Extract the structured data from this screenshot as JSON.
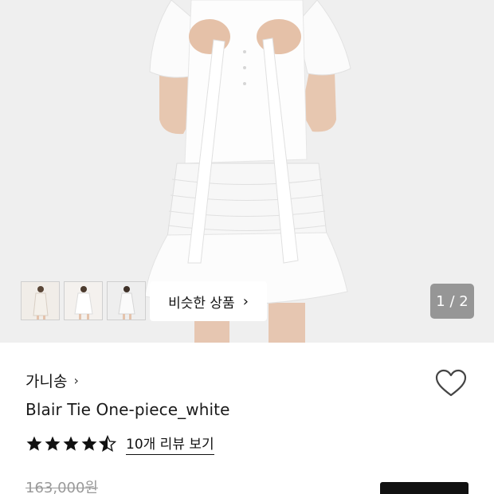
{
  "gallery": {
    "similar_button_label": "비슷한 상품",
    "similar_button_chevron": "›",
    "pager_text": "1 / 2",
    "thumbnails": [
      "thumb-1",
      "thumb-2",
      "thumb-3"
    ]
  },
  "product": {
    "brand_name": "가니송",
    "brand_chevron": "›",
    "title": "Blair Tie One-piece_white",
    "rating_stars": 4.5,
    "reviews_link": "10개 리뷰 보기",
    "original_price": "163,000원"
  },
  "icons": {
    "heart": "heart-outline-icon",
    "star": "star-icon",
    "chevron": "chevron-right-icon"
  },
  "colors": {
    "star": "#111111",
    "hero_background": "#efefef",
    "pager_background": "#7a7a7a",
    "buy_button": "#111111"
  }
}
